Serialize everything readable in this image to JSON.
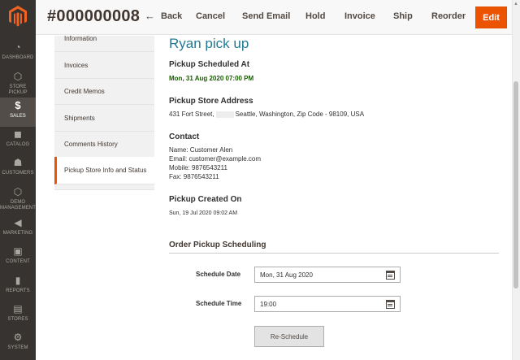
{
  "menu": {
    "items": [
      {
        "label": "DASHBOARD",
        "icon": "dashboard-icon",
        "glyph": "◔"
      },
      {
        "label": "STORE PICKUP",
        "icon": "hexagon-icon",
        "glyph": "⬡"
      },
      {
        "label": "SALES",
        "icon": "dollar-icon",
        "glyph": "$"
      },
      {
        "label": "CATALOG",
        "icon": "box-icon",
        "glyph": "◼"
      },
      {
        "label": "CUSTOMERS",
        "icon": "person-icon",
        "glyph": "☗"
      },
      {
        "label": "DEMO MANAGEMENT",
        "icon": "hexagon-icon",
        "glyph": "⬡"
      },
      {
        "label": "MARKETING",
        "icon": "megaphone-icon",
        "glyph": "◀"
      },
      {
        "label": "CONTENT",
        "icon": "layout-icon",
        "glyph": "▣"
      },
      {
        "label": "REPORTS",
        "icon": "bar-chart-icon",
        "glyph": "▮"
      },
      {
        "label": "STORES",
        "icon": "store-icon",
        "glyph": "▤"
      },
      {
        "label": "SYSTEM",
        "icon": "gear-icon",
        "glyph": "⚙"
      }
    ]
  },
  "header": {
    "order_number": "#000000008",
    "back_label": "Back",
    "cancel_label": "Cancel",
    "send_email_label": "Send Email",
    "hold_label": "Hold",
    "invoice_label": "Invoice",
    "ship_label": "Ship",
    "reorder_label": "Reorder",
    "edit_label": "Edit"
  },
  "tabs": [
    {
      "label": "Information"
    },
    {
      "label": "Invoices"
    },
    {
      "label": "Credit Memos"
    },
    {
      "label": "Shipments"
    },
    {
      "label": "Comments History"
    },
    {
      "label": "Pickup Store Info and Status"
    }
  ],
  "pickup": {
    "title": "Ryan pick up",
    "scheduled_heading": "Pickup Scheduled At",
    "scheduled_value": "Mon, 31 Aug 2020 07:00 PM",
    "address_heading": "Pickup Store Address",
    "address_part1": "431 Fort Street,",
    "address_part2": "Seattle, Washington, Zip Code - 98109, USA",
    "contact_heading": "Contact",
    "contact_name": "Name: Customer Alen",
    "contact_email": "Email: customer@example.com",
    "contact_mobile": "Mobile: 9876543211",
    "contact_fax": "Fax: 9876543211",
    "created_heading": "Pickup Created On",
    "created_value": "Sun, 19 Jul 2020 09:02 AM"
  },
  "scheduling": {
    "heading": "Order Pickup Scheduling",
    "date_label": "Schedule Date",
    "date_value": "Mon, 31 Aug 2020",
    "time_label": "Schedule Time",
    "time_value": "19:00",
    "button_label": "Re-Schedule"
  },
  "colors": {
    "accent": "#eb5202",
    "sidebar_bg": "#373330",
    "title_blue": "#247895",
    "scheduled_green": "#185b00"
  }
}
